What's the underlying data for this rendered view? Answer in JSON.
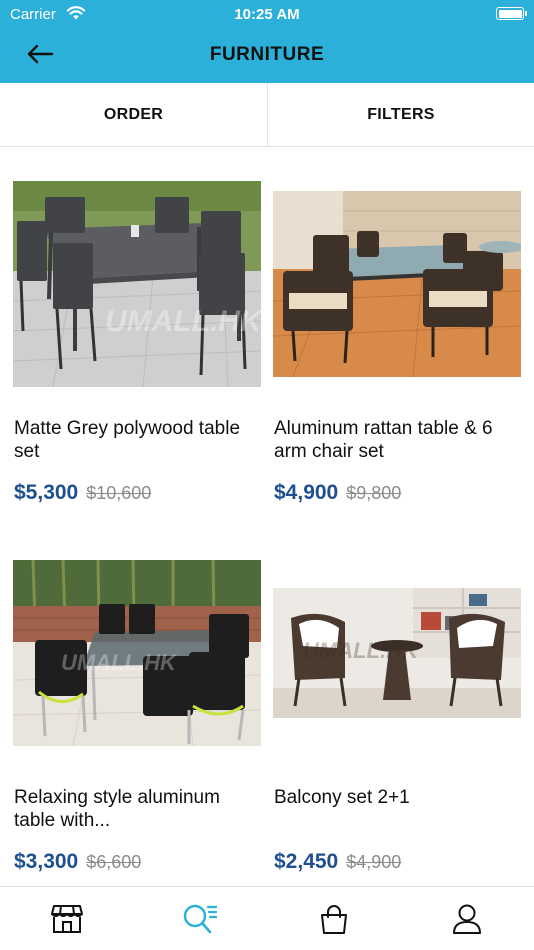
{
  "status_bar": {
    "carrier": "Carrier",
    "time": "10:25 AM"
  },
  "header": {
    "title": "FURNITURE"
  },
  "tabs": [
    {
      "label": "ORDER"
    },
    {
      "label": "FILTERS"
    }
  ],
  "products": [
    {
      "name": "Matte Grey polywood table set",
      "price": "$5,300",
      "old_price": "$10,600"
    },
    {
      "name": "Aluminum rattan table & 6 arm chair set",
      "price": "$4,900",
      "old_price": "$9,800"
    },
    {
      "name": "Relaxing style aluminum table with...",
      "price": "$3,300",
      "old_price": "$6,600"
    },
    {
      "name": "Balcony set 2+1",
      "price": "$2,450",
      "old_price": "$4,900"
    }
  ],
  "bottom_nav": [
    {
      "icon": "store-icon",
      "active": false
    },
    {
      "icon": "search-list-icon",
      "active": true
    },
    {
      "icon": "shopping-bag-icon",
      "active": false
    },
    {
      "icon": "user-icon",
      "active": false
    }
  ],
  "colors": {
    "header_bg": "#2bb1d9",
    "price": "#1e4f8f",
    "active_nav": "#2bb1d9"
  }
}
